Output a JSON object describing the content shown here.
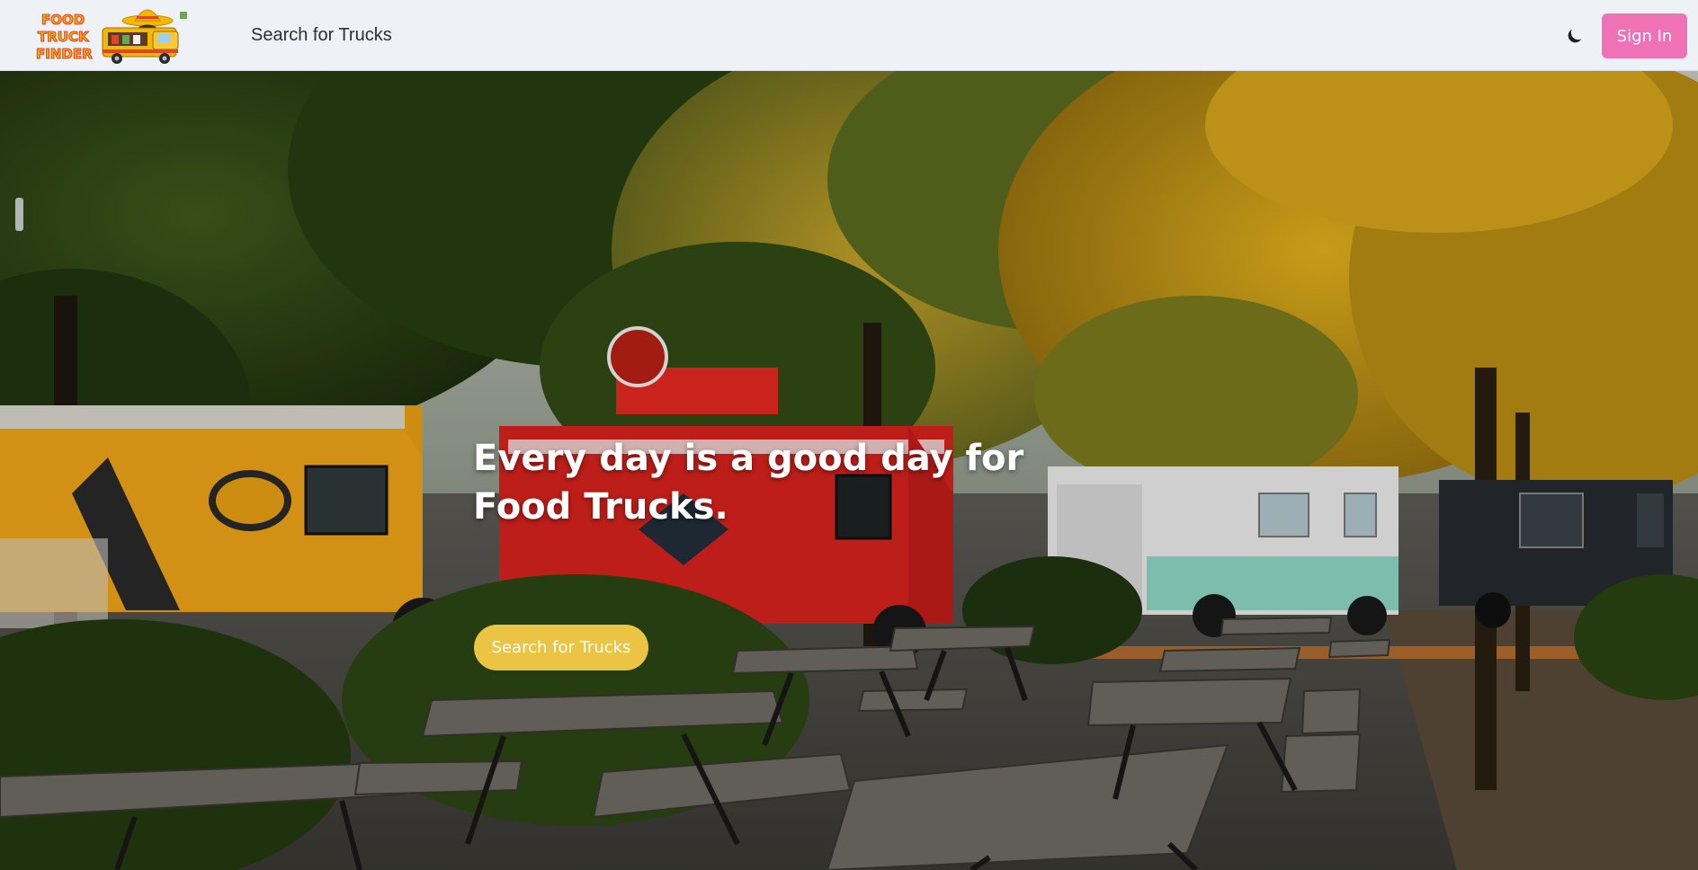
{
  "navbar": {
    "logo": {
      "text_lines": [
        "FOOD",
        "TRUCK",
        "FINDER"
      ]
    },
    "search_link": "Search for Trucks",
    "theme_toggle_icon": "moon-icon",
    "sign_in_label": "Sign In"
  },
  "hero": {
    "title": "Every day is a good day for Food Trucks.",
    "cta_label": "Search for Trucks"
  },
  "colors": {
    "navbar_bg": "#eef2f7",
    "sign_in_bg": "#ee72b5",
    "cta_bg": "#ecc444",
    "logo_yellow": "#f5b800",
    "logo_red": "#e0452a"
  }
}
